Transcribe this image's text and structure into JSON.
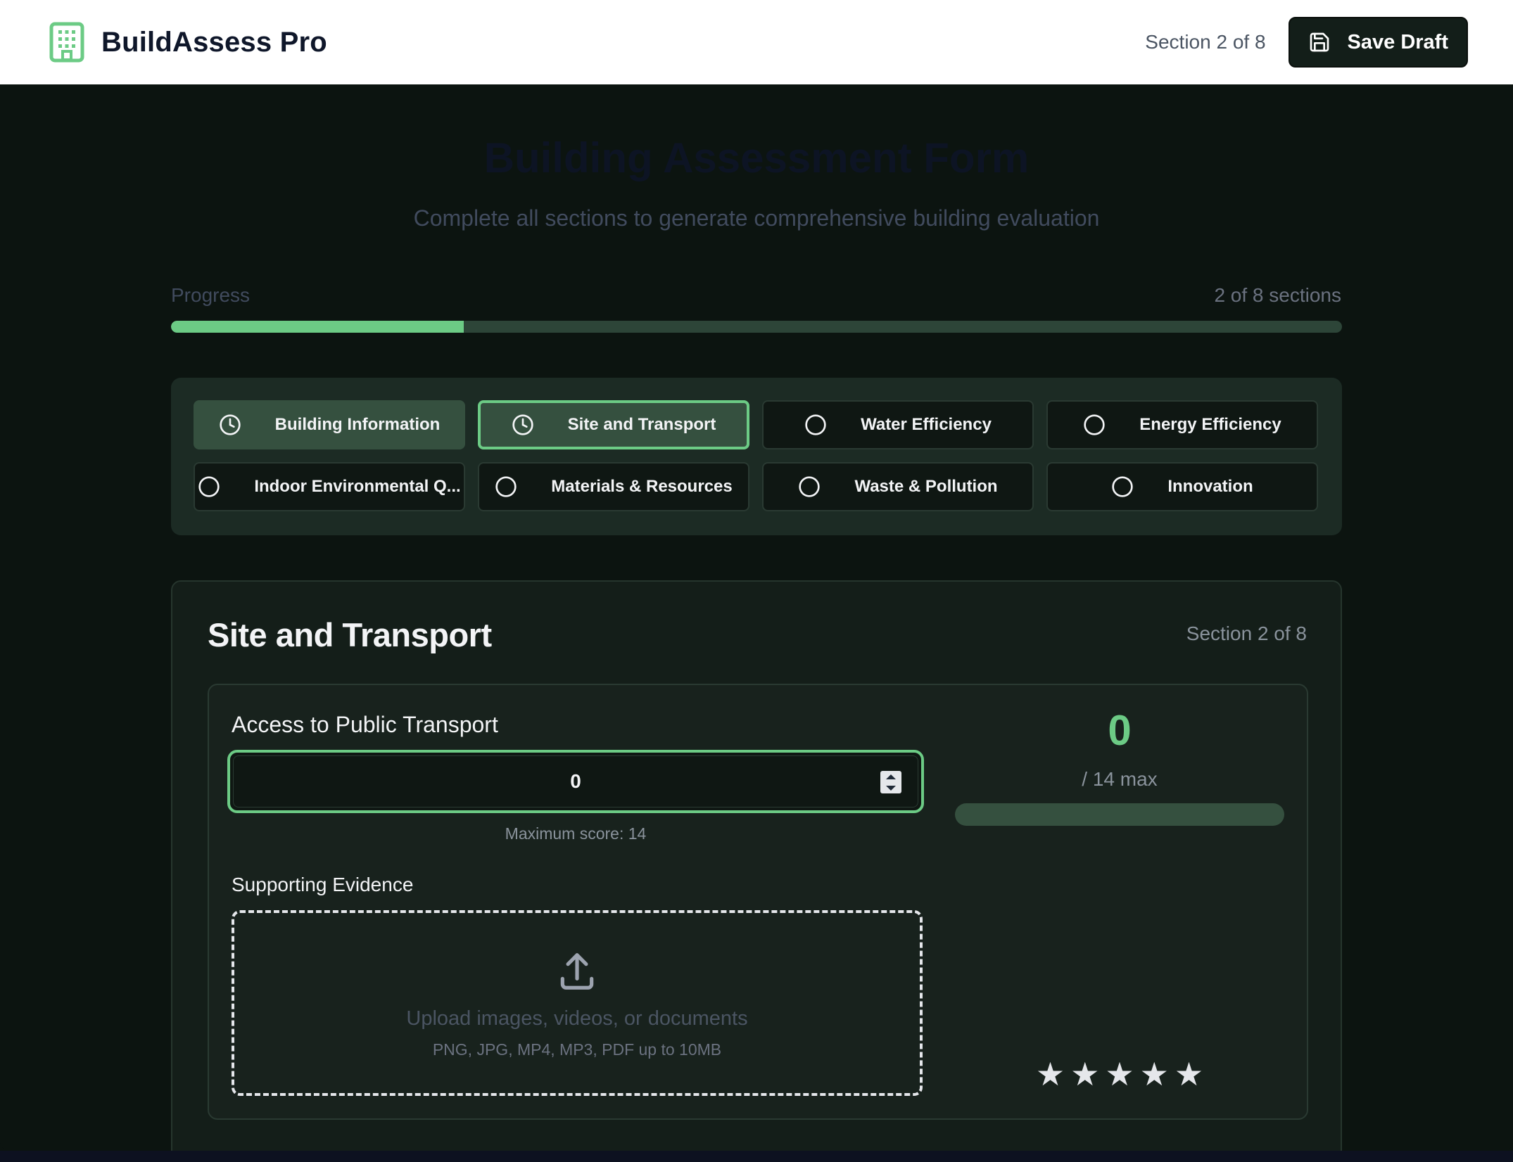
{
  "app": {
    "name": "BuildAssess Pro",
    "section_indicator": "Section 2 of 8",
    "save_label": "Save Draft"
  },
  "page": {
    "title": "Building Assessment Form",
    "subtitle": "Complete all sections to generate comprehensive building evaluation"
  },
  "progress": {
    "label": "Progress",
    "count_text": "2 of 8 sections",
    "completed": 2,
    "total": 8,
    "fraction": 0.25
  },
  "tabs": [
    {
      "label": "Building Information",
      "state": "done",
      "icon": "clock-icon"
    },
    {
      "label": "Site and Transport",
      "state": "active",
      "icon": "clock-icon"
    },
    {
      "label": "Water Efficiency",
      "state": "pending",
      "icon": "circle-icon"
    },
    {
      "label": "Energy Efficiency",
      "state": "pending",
      "icon": "circle-icon"
    },
    {
      "label": "Indoor Environmental Q...",
      "state": "pending",
      "icon": "circle-icon"
    },
    {
      "label": "Materials & Resources",
      "state": "pending",
      "icon": "circle-icon"
    },
    {
      "label": "Waste & Pollution",
      "state": "pending",
      "icon": "circle-icon"
    },
    {
      "label": "Innovation",
      "state": "pending",
      "icon": "circle-icon"
    }
  ],
  "section": {
    "title": "Site and Transport",
    "number_text": "Section 2 of 8",
    "criterion": {
      "label": "Access to Public Transport",
      "value": "0",
      "max_hint": "Maximum score: 14",
      "score": "0",
      "max_text": "/ 14 max",
      "score_fraction": 0,
      "evidence_label": "Supporting Evidence",
      "upload_text": "Upload images, videos, or documents",
      "upload_hint": "PNG, JPG, MP4, MP3, PDF up to 10MB",
      "stars": [
        "★",
        "★",
        "★",
        "★",
        "★"
      ],
      "rating": 0
    }
  },
  "colors": {
    "accent": "#6ccb85",
    "panel": "#1c2b24",
    "background": "#0c1410"
  }
}
